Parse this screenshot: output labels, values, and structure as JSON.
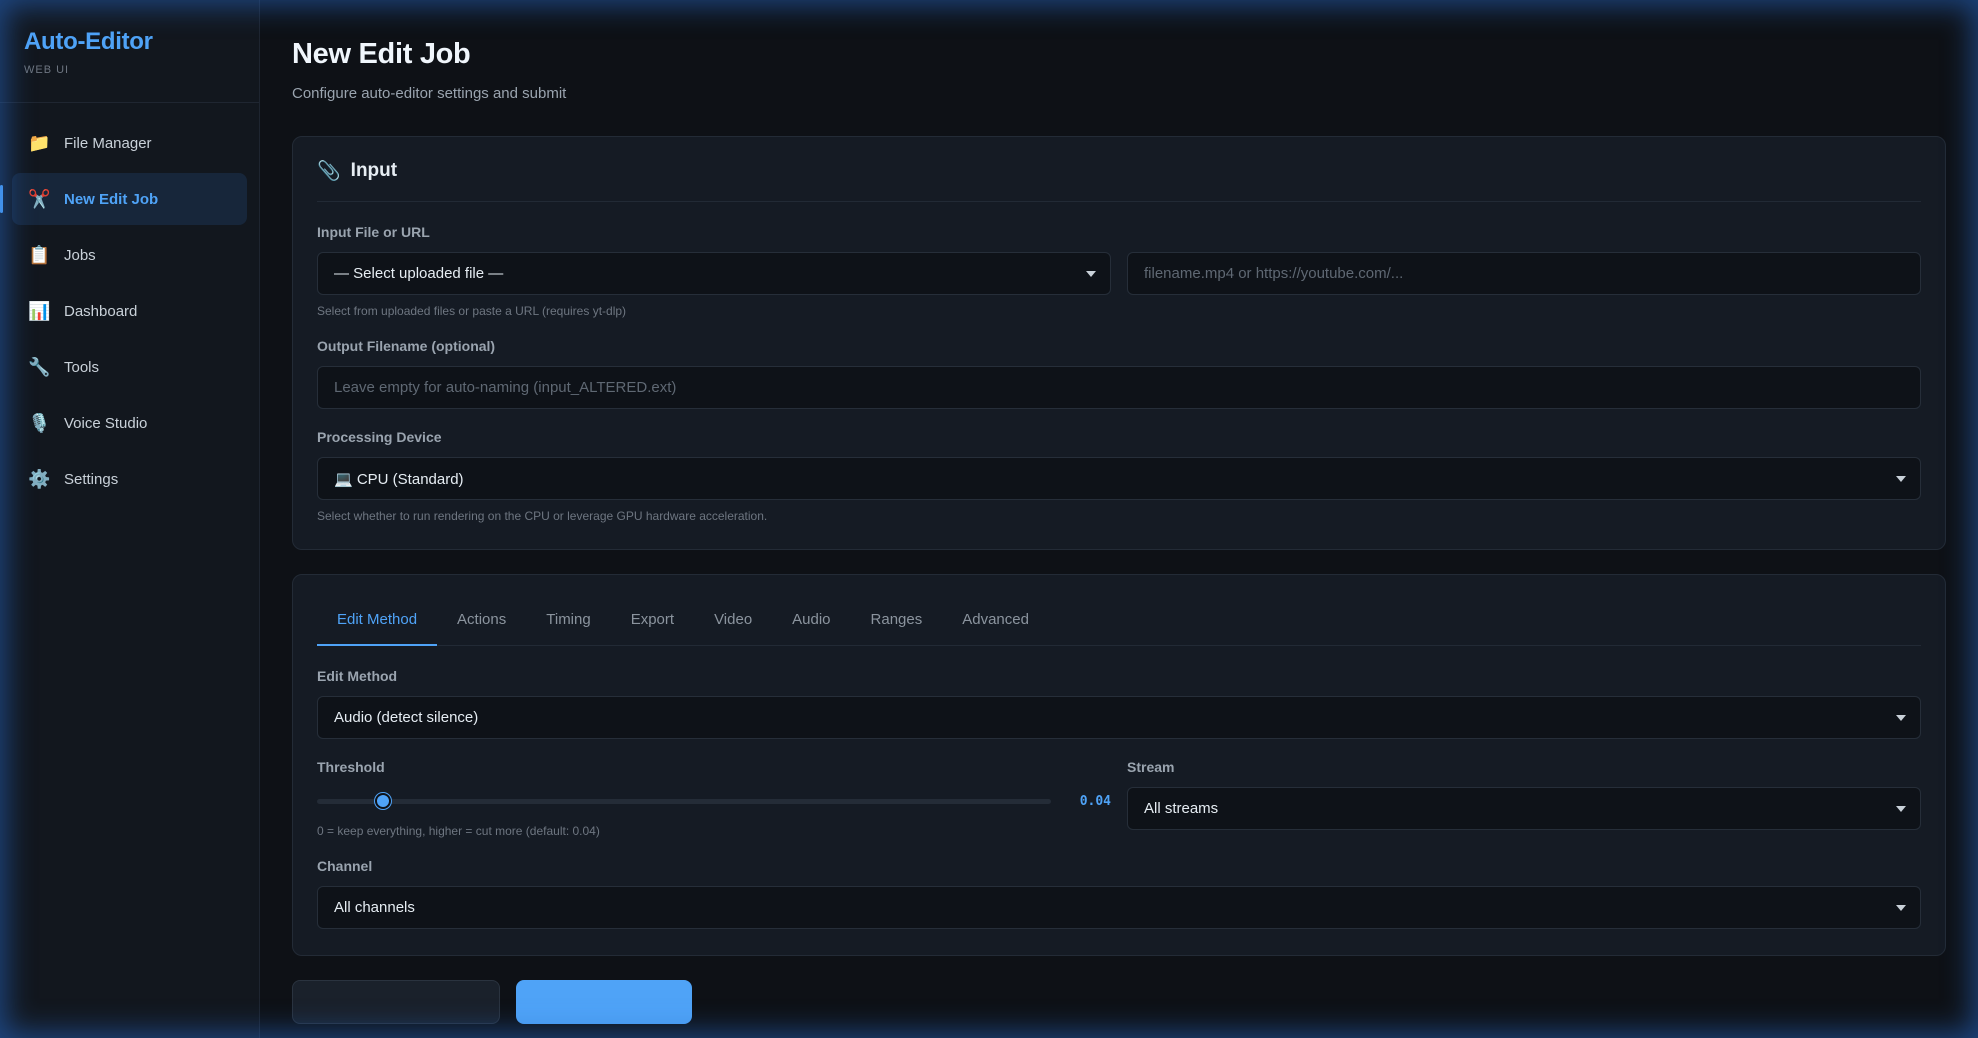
{
  "brand": {
    "name": "Auto-Editor",
    "subtitle": "WEB UI"
  },
  "nav": [
    {
      "label": "File Manager",
      "icon": "📁",
      "name": "folder-icon"
    },
    {
      "label": "New Edit Job",
      "icon": "✂️",
      "name": "scissors-icon",
      "active": true
    },
    {
      "label": "Jobs",
      "icon": "📋",
      "name": "clipboard-icon"
    },
    {
      "label": "Dashboard",
      "icon": "📊",
      "name": "bar-chart-icon"
    },
    {
      "label": "Tools",
      "icon": "🔧",
      "name": "wrench-icon"
    },
    {
      "label": "Voice Studio",
      "icon": "🎙️",
      "name": "microphone-icon"
    },
    {
      "label": "Settings",
      "icon": "⚙️",
      "name": "gear-icon"
    }
  ],
  "page": {
    "title": "New Edit Job",
    "subtitle": "Configure auto-editor settings and submit"
  },
  "input_card": {
    "title": "Input",
    "icon": "📎",
    "input_label": "Input File or URL",
    "file_select": "— Select uploaded file —",
    "url_placeholder": "filename.mp4 or https://youtube.com/...",
    "input_help": "Select from uploaded files or paste a URL (requires yt-dlp)",
    "output_label": "Output Filename (optional)",
    "output_placeholder": "Leave empty for auto-naming (input_ALTERED.ext)",
    "device_label": "Processing Device",
    "device_value": "💻 CPU (Standard)",
    "device_help": "Select whether to run rendering on the CPU or leverage GPU hardware acceleration."
  },
  "tabs": [
    "Edit Method",
    "Actions",
    "Timing",
    "Export",
    "Video",
    "Audio",
    "Ranges",
    "Advanced"
  ],
  "active_tab": "Edit Method",
  "edit_card": {
    "method_label": "Edit Method",
    "method_value": "Audio (detect silence)",
    "threshold_label": "Threshold",
    "threshold_value": "0.04",
    "threshold_level": 0.09,
    "threshold_help": "0 = keep everything, higher = cut more (default: 0.04)",
    "stream_label": "Stream",
    "stream_value": "All streams",
    "channel_label": "Channel",
    "channel_value": "All channels"
  },
  "colors": {
    "accent": "#4fa3f7",
    "background": "#0e1116",
    "card": "#151b24"
  }
}
